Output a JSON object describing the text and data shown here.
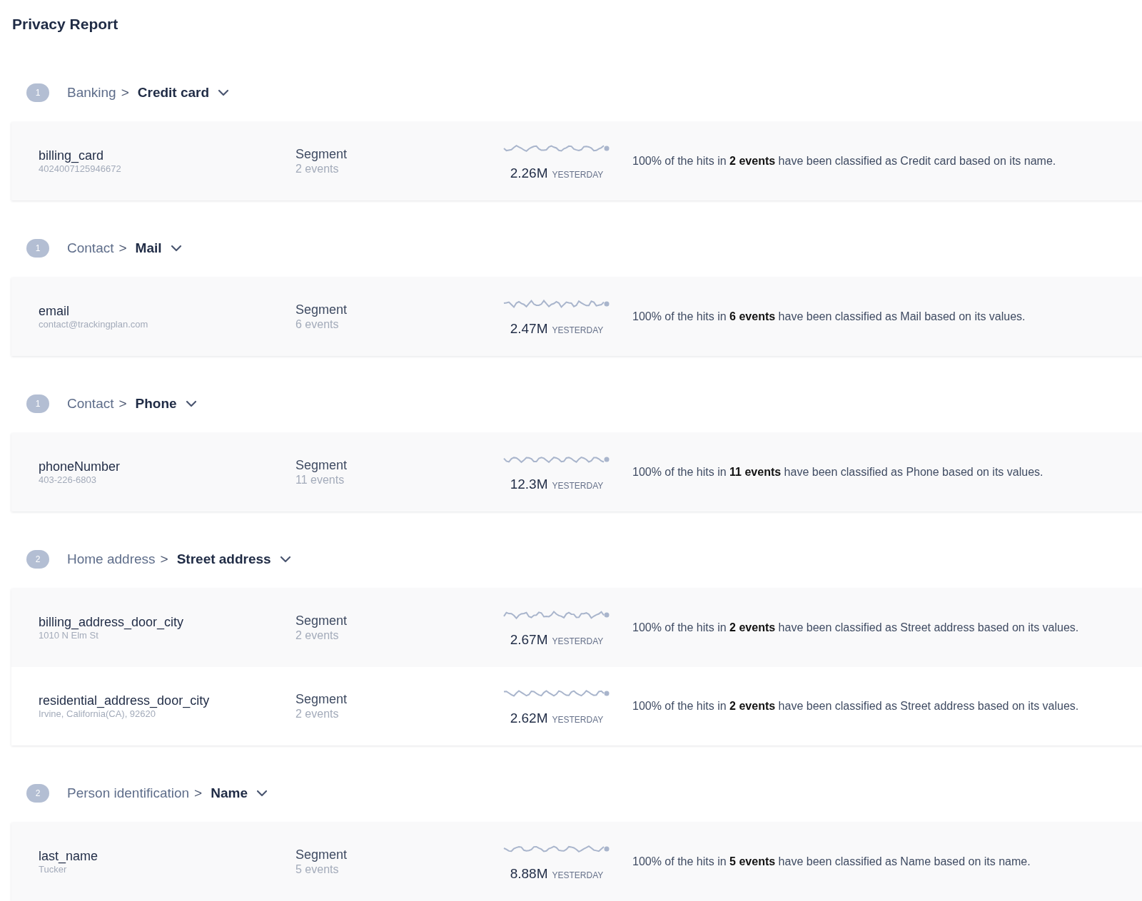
{
  "title": "Privacy Report",
  "groups": [
    {
      "count": "1",
      "category": "Banking",
      "separator": ">",
      "subcategory": "Credit card",
      "rows": [
        {
          "name": "billing_card",
          "example": "4024007125946672",
          "source": "Segment",
          "events": "2 events",
          "value": "2.26M",
          "period": "YESTERDAY",
          "description": "100% of the hits in **2 events** have been classified as Credit card based on its name."
        }
      ]
    },
    {
      "count": "1",
      "category": "Contact",
      "separator": ">",
      "subcategory": "Mail",
      "rows": [
        {
          "name": "email",
          "example": "contact@trackingplan.com",
          "source": "Segment",
          "events": "6 events",
          "value": "2.47M",
          "period": "YESTERDAY",
          "description": "100% of the hits in **6 events** have been classified as Mail based on its values."
        }
      ]
    },
    {
      "count": "1",
      "category": "Contact",
      "separator": ">",
      "subcategory": "Phone",
      "rows": [
        {
          "name": "phoneNumber",
          "example": "403-226-6803",
          "source": "Segment",
          "events": "11 events",
          "value": "12.3M",
          "period": "YESTERDAY",
          "description": "100% of the hits in **11 events** have been classified as Phone based on its values."
        }
      ]
    },
    {
      "count": "2",
      "category": "Home address",
      "separator": ">",
      "subcategory": "Street address",
      "rows": [
        {
          "name": "billing_address_door_city",
          "example": "1010 N Elm St",
          "source": "Segment",
          "events": "2 events",
          "value": "2.67M",
          "period": "YESTERDAY",
          "description": "100% of the hits in **2 events** have been classified as Street address based on its values."
        },
        {
          "name": "residential_address_door_city",
          "example": "Irvine, California(CA), 92620",
          "source": "Segment",
          "events": "2 events",
          "value": "2.62M",
          "period": "YESTERDAY",
          "description": "100% of the hits in **2 events** have been classified as Street address based on its values."
        }
      ]
    },
    {
      "count": "2",
      "category": "Person identification",
      "separator": ">",
      "subcategory": "Name",
      "rows": [
        {
          "name": "last_name",
          "example": "Tucker",
          "source": "Segment",
          "events": "5 events",
          "value": "8.88M",
          "period": "YESTERDAY",
          "description": "100% of the hits in **5 events** have been classified as Name based on its name."
        }
      ]
    }
  ]
}
